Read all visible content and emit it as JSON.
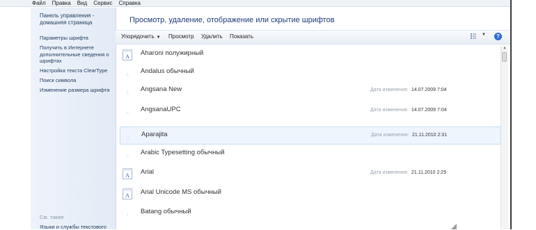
{
  "menu": [
    "Файл",
    "Правка",
    "Вид",
    "Сервис",
    "Справка"
  ],
  "sidebar": {
    "home": "Панель управления - домашняя страница",
    "links": [
      "Параметры шрифта",
      "Получить в Интернете дополнительные сведения о шрифтах",
      "Настройка текста ClearType",
      "Поиск символа",
      "Изменение размера шрифта"
    ],
    "see_also": "См. также",
    "see_also_link": "Языки и службы текстового"
  },
  "header": {
    "title": "Просмотр, удаление, отображение или скрытие шрифтов"
  },
  "toolbar": {
    "organize": "Упорядочить",
    "preview": "Просмотр",
    "delete": "Удалить",
    "show": "Показать",
    "help": "?"
  },
  "fonts": [
    {
      "name": "Aharoni полужирный",
      "icon": "font-icon-a",
      "date_label": "",
      "date": ""
    },
    {
      "name": "Andalus обычный",
      "icon": "font-icon-faded",
      "date_label": "",
      "date": ""
    },
    {
      "name": "Angsana New",
      "icon": "font-icon-faded",
      "date_label": "Дата изменения:",
      "date": "14.07.2009 7:04"
    },
    {
      "name": "AngsanaUPC",
      "icon": "font-icon-faded",
      "date_label": "Дата изменения:",
      "date": "14.07.2009 7:04"
    },
    {
      "name": "Aparajita",
      "icon": "font-icon-faded",
      "date_label": "Дата изменения:",
      "date": "21.11.2010 2:31"
    },
    {
      "name": "Arabic Typesetting обычный",
      "icon": "font-icon-faded",
      "date_label": "",
      "date": ""
    },
    {
      "name": "Arial",
      "icon": "font-icon-a",
      "date_label": "Дата изменения:",
      "date": "21.11.2010 2:29"
    },
    {
      "name": "Arial Unicode MS обычный",
      "icon": "font-icon-a",
      "date_label": "",
      "date": ""
    },
    {
      "name": "Batang обычный",
      "icon": "font-icon-faded",
      "date_label": "",
      "date": ""
    }
  ],
  "colors": {
    "accent": "#1e3a7a",
    "link": "#1e395b",
    "selection": "#eef5fd"
  }
}
